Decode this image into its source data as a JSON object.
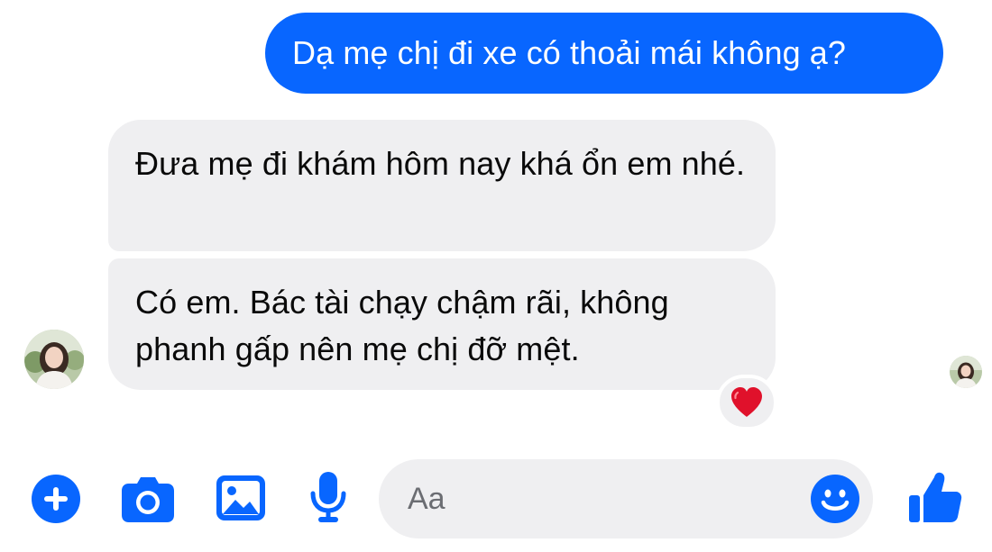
{
  "conversation": {
    "messages": [
      {
        "direction": "outgoing",
        "text": "Dạ mẹ chị đi xe có thoải mái không ạ?"
      },
      {
        "direction": "incoming",
        "text": "Đưa mẹ đi khám hôm nay khá ổn em nhé."
      },
      {
        "direction": "incoming",
        "text": "Có em. Bác tài chạy chậm rãi, không phanh gấp nên mẹ chị đỡ mệt.",
        "reaction": "heart"
      }
    ]
  },
  "composer": {
    "placeholder": "Aa"
  },
  "icons": {
    "add": "plus-circle-icon",
    "camera": "camera-icon",
    "gallery": "image-icon",
    "voice": "microphone-icon",
    "emoji": "smiley-icon",
    "like": "thumbs-up-icon",
    "reaction": "heart-icon"
  },
  "colors": {
    "accent": "#0866ff",
    "incoming_bubble": "#efeff1",
    "reaction_heart": "#e0112b"
  }
}
